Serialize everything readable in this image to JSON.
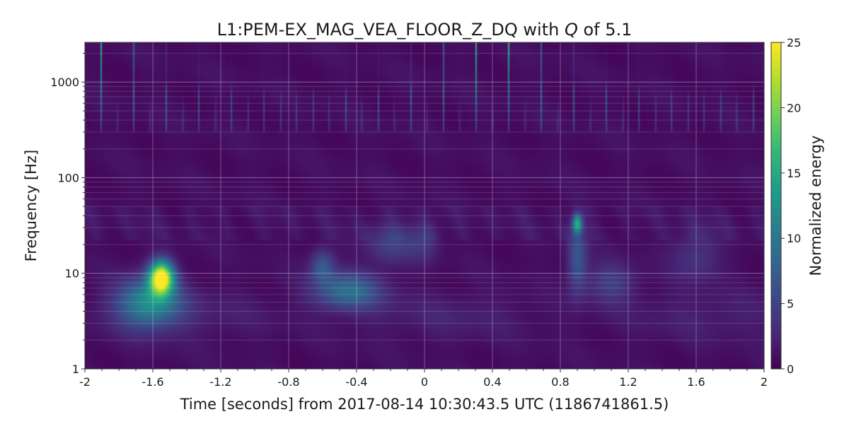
{
  "chart_data": {
    "type": "heatmap",
    "title": "L1:PEM-EX_MAG_VEA_FLOOR_Z_DQ with Q of 5.1",
    "title_parts": {
      "prefix": "L1:PEM-EX_MAG_VEA_FLOOR_Z_DQ with ",
      "q_symbol": "Q",
      "suffix": " of 5.1"
    },
    "xlabel": "Time [seconds] from 2017-08-14 10:30:43.5 UTC (1186741861.5)",
    "ylabel": "Frequency [Hz]",
    "colorbar_label": "Normalized energy",
    "xlim": [
      -2,
      2
    ],
    "ylim": [
      1,
      2600
    ],
    "y_scale": "log",
    "x_ticks": [
      -2,
      -1.6,
      -1.2,
      -0.8,
      -0.4,
      0,
      0.4,
      0.8,
      1.2,
      1.6,
      2
    ],
    "x_tick_labels": [
      "-2",
      "-1.6",
      "-1.2",
      "-0.8",
      "-0.4",
      "0",
      "0.4",
      "0.8",
      "1.2",
      "1.6",
      "2"
    ],
    "y_ticks": [
      1,
      10,
      100,
      1000
    ],
    "y_tick_labels": [
      "1",
      "10",
      "100",
      "1000"
    ],
    "colorbar_range": [
      0,
      25
    ],
    "colorbar_ticks": [
      0,
      5,
      10,
      15,
      20,
      25
    ],
    "colorbar_tick_labels": [
      "0",
      "5",
      "10",
      "15",
      "20",
      "25"
    ],
    "colormap": "viridis",
    "grid": true,
    "features": [
      {
        "time": -1.55,
        "frequency": 9,
        "energy": 25,
        "time_width": 0.05,
        "log_freq_width": 0.12
      },
      {
        "time": -1.62,
        "frequency": 5,
        "energy": 11,
        "time_width": 0.13,
        "log_freq_width": 0.18
      },
      {
        "time": -0.45,
        "frequency": 6.5,
        "energy": 8,
        "time_width": 0.14,
        "log_freq_width": 0.14
      },
      {
        "time": -0.6,
        "frequency": 12,
        "energy": 6,
        "time_width": 0.05,
        "log_freq_width": 0.12
      },
      {
        "time": -0.2,
        "frequency": 20,
        "energy": 4,
        "time_width": 0.1,
        "log_freq_width": 0.15
      },
      {
        "time": 0.0,
        "frequency": 22,
        "energy": 3,
        "time_width": 0.06,
        "log_freq_width": 0.15
      },
      {
        "time": 0.9,
        "frequency": 33,
        "energy": 13,
        "time_width": 0.02,
        "log_freq_width": 0.07
      },
      {
        "time": 0.9,
        "frequency": 14,
        "energy": 6,
        "time_width": 0.04,
        "log_freq_width": 0.25
      },
      {
        "time": 1.1,
        "frequency": 8,
        "energy": 4,
        "time_width": 0.1,
        "log_freq_width": 0.15
      },
      {
        "time": 1.6,
        "frequency": 15,
        "energy": 3,
        "time_width": 0.1,
        "log_freq_width": 0.2
      }
    ],
    "high_frequency_spikes": {
      "period": 0.096,
      "min_frequency": 300,
      "peak_energy": 22
    }
  },
  "colors": {
    "viridis_stops": [
      "#440154",
      "#482878",
      "#3e4989",
      "#31688e",
      "#26828e",
      "#1f9e89",
      "#35b779",
      "#6ece58",
      "#b5de2b",
      "#fde725"
    ],
    "grid": "#ffffff",
    "text": "#1a1a1a"
  }
}
